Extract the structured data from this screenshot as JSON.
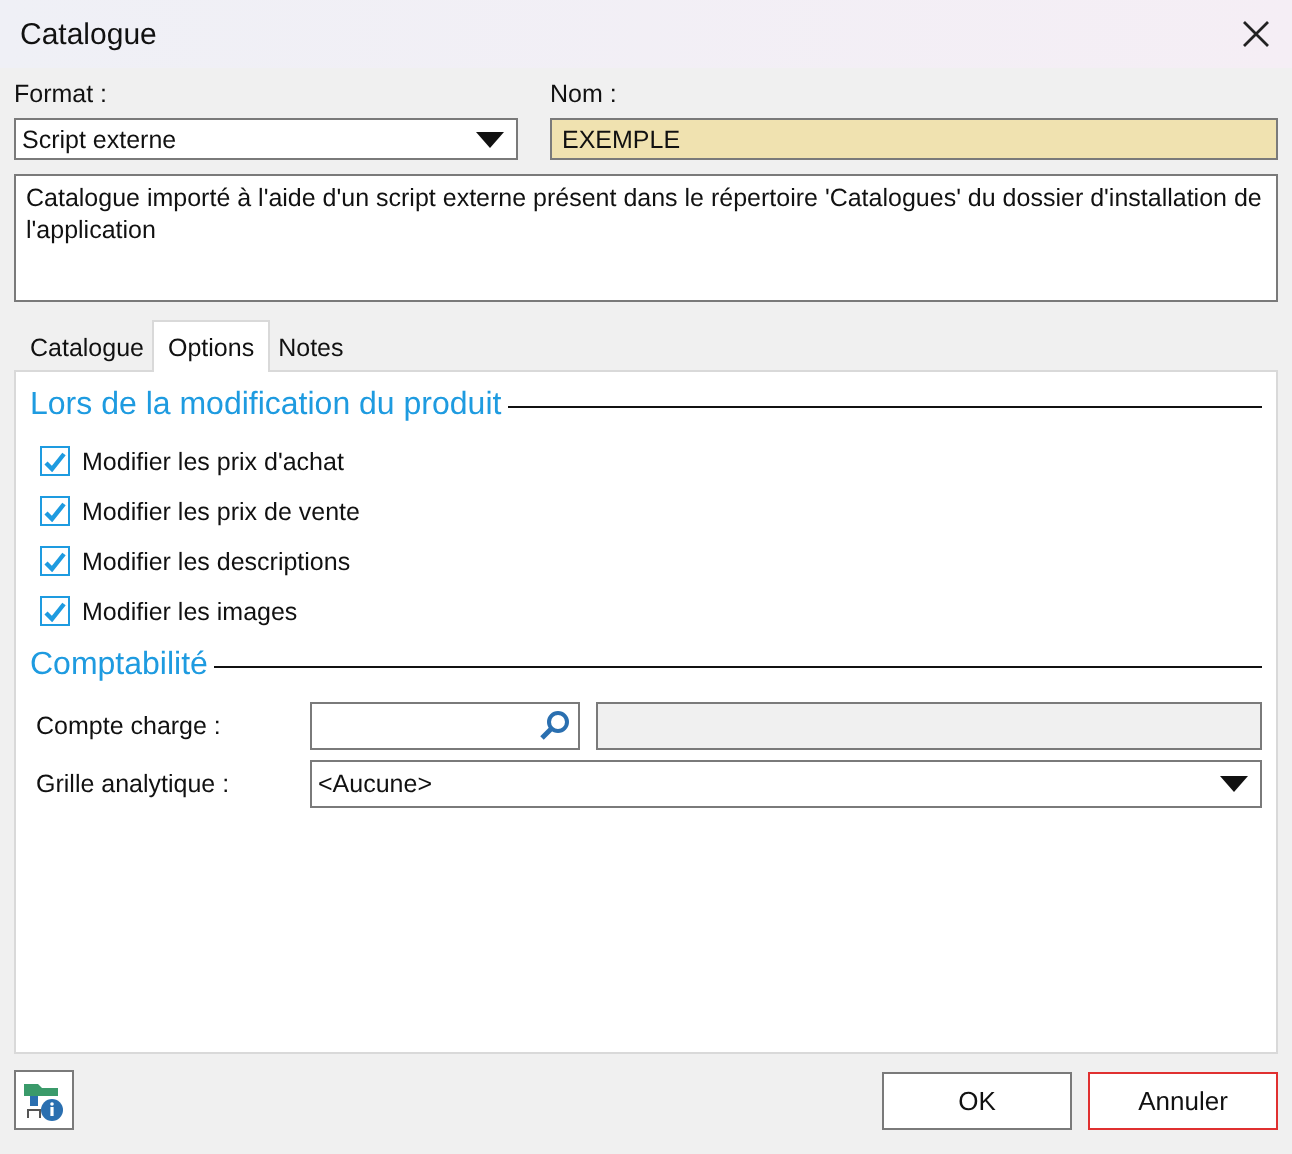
{
  "window": {
    "title": "Catalogue"
  },
  "format": {
    "label": "Format :",
    "value": "Script externe"
  },
  "nom": {
    "label": "Nom :",
    "value": "EXEMPLE"
  },
  "description": "Catalogue importé à l'aide d'un script externe présent dans le répertoire 'Catalogues' du dossier d'installation de l'application",
  "tabs": [
    {
      "label": "Catalogue",
      "selected": false
    },
    {
      "label": "Options",
      "selected": true
    },
    {
      "label": "Notes",
      "selected": false
    }
  ],
  "sections": [
    {
      "title": "Lors de la modification du produit",
      "items": [
        {
          "kind": "checkbox",
          "label": "Modifier les prix d'achat",
          "checked": true
        },
        {
          "kind": "checkbox",
          "label": "Modifier les prix de vente",
          "checked": true
        },
        {
          "kind": "checkbox",
          "label": "Modifier les descriptions",
          "checked": true
        },
        {
          "kind": "checkbox",
          "label": "Modifier les images",
          "checked": true
        }
      ]
    },
    {
      "title": "Comptabilité",
      "items": [
        {
          "kind": "lookup",
          "label": "Compte charge :"
        },
        {
          "kind": "dropdown",
          "label": "Grille analytique :",
          "value": "<Aucune>"
        }
      ]
    }
  ],
  "buttons": [
    {
      "label": "OK",
      "kind": "default"
    },
    {
      "label": "Annuler",
      "kind": "focused"
    }
  ]
}
